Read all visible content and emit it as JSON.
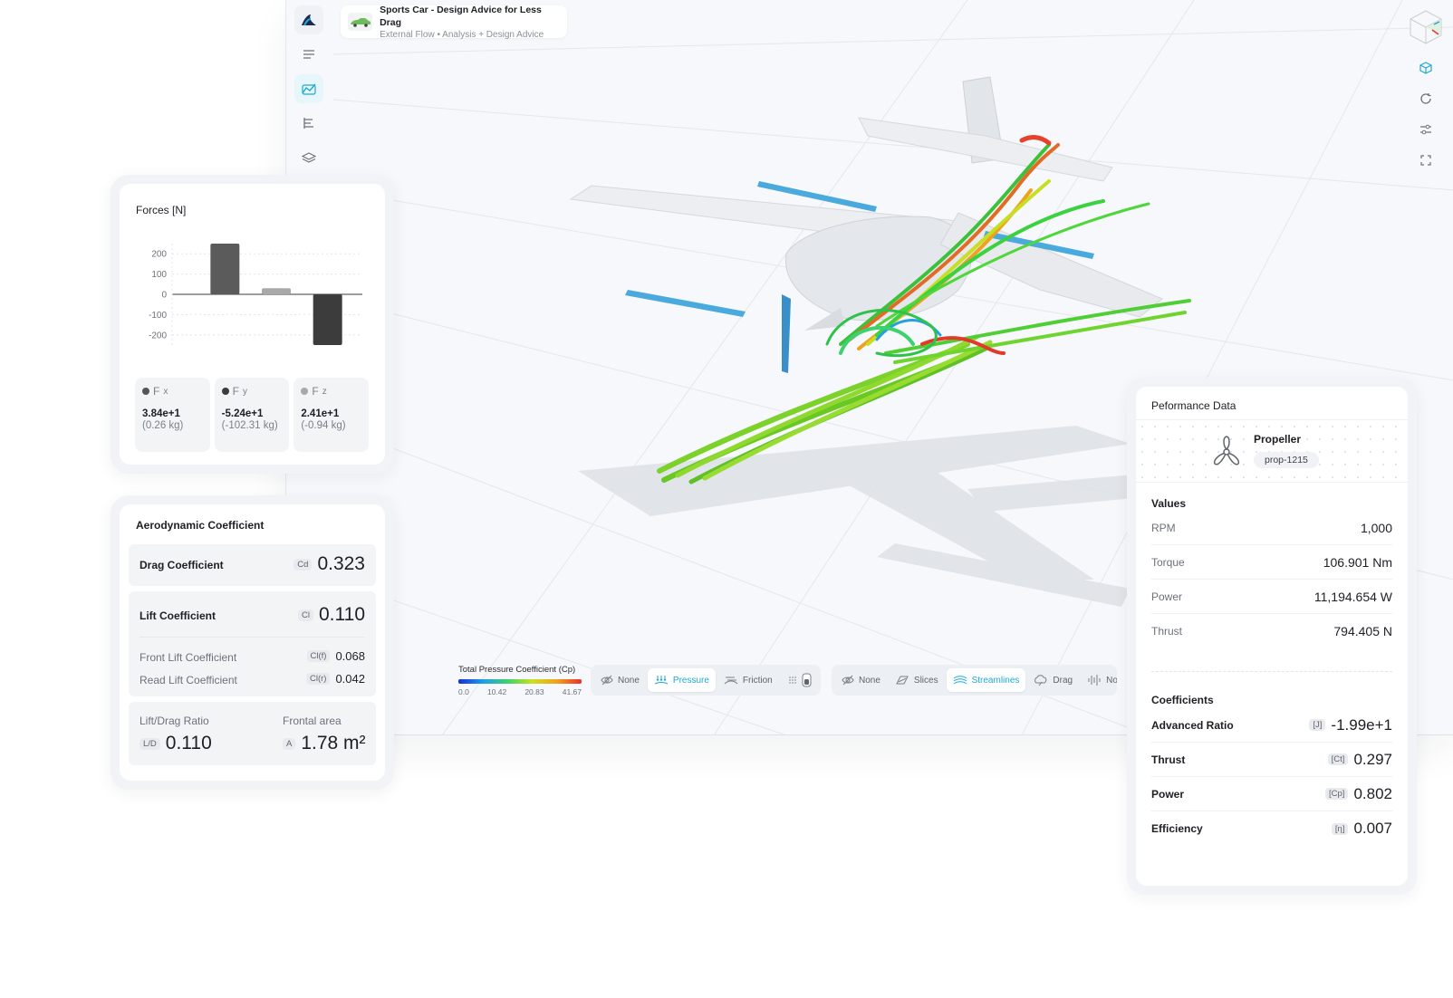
{
  "project": {
    "title": "Sports Car - Design Advice for Less Drag",
    "subtitle": "External Flow • Analysis + Design Advice"
  },
  "legend": {
    "title": "Total Pressure Coefficient (Cp)",
    "ticks": [
      "0.0",
      "10.42",
      "20.83",
      "41.67"
    ]
  },
  "surface_toggle": {
    "options": [
      {
        "label": "None",
        "icon": "eye-off-icon"
      },
      {
        "label": "Pressure",
        "icon": "pressure-icon",
        "active": true
      },
      {
        "label": "Friction",
        "icon": "friction-icon"
      }
    ]
  },
  "flow_toggle": {
    "options": [
      {
        "label": "None",
        "icon": "eye-off-icon"
      },
      {
        "label": "Slices",
        "icon": "slices-icon"
      },
      {
        "label": "Streamlines",
        "icon": "streamlines-icon",
        "active": true
      },
      {
        "label": "Drag",
        "icon": "drag-icon"
      },
      {
        "label": "No",
        "icon": "noise-icon"
      }
    ]
  },
  "forces": {
    "title": "Forces [N]",
    "cards": [
      {
        "axis": "F",
        "sub": "x",
        "value": "3.84e+1",
        "mass": "(0.26 kg)",
        "color": "#555555"
      },
      {
        "axis": "F",
        "sub": "y",
        "value": "-5.24e+1",
        "mass": "(-102.31 kg)",
        "color": "#3c3c3c"
      },
      {
        "axis": "F",
        "sub": "z",
        "value": "2.41e+1",
        "mass": "(-0.94 kg)",
        "color": "#a9a9a9"
      }
    ]
  },
  "chart_data": {
    "type": "bar",
    "title": "Forces [N]",
    "categories": [
      "Fx",
      "Fz",
      "Fy"
    ],
    "values": [
      250,
      30,
      -250
    ],
    "colors": [
      "#5b5b5b",
      "#a9a9a9",
      "#3c3c3c"
    ],
    "yticks": [
      "200",
      "100",
      "0",
      "-100",
      "-200"
    ],
    "ylim": [
      -250,
      250
    ],
    "grid": true
  },
  "aero": {
    "title": "Aerodynamic Coefficient",
    "drag": {
      "label": "Drag Coefficient",
      "symbol": "Cd",
      "value": "0.323"
    },
    "lift": {
      "label": "Lift Coefficient",
      "symbol": "Cl",
      "value": "0.110"
    },
    "front_lift": {
      "label": "Front Lift Coefficient",
      "symbol": "Cl(f)",
      "value": "0.068"
    },
    "read_lift": {
      "label": "Read Lift Coefficient",
      "symbol": "Cl(r)",
      "value": "0.042"
    },
    "ld": {
      "label": "Lift/Drag Ratio",
      "symbol": "L/D",
      "value": "0.110"
    },
    "area": {
      "label": "Frontal area",
      "symbol": "A",
      "value": "1.78 m²"
    }
  },
  "performance": {
    "title": "Peformance Data",
    "propeller": {
      "name": "Propeller",
      "id": "prop-1215"
    },
    "values_title": "Values",
    "values": [
      {
        "label": "RPM",
        "value": "1,000"
      },
      {
        "label": "Torque",
        "value": "106.901 Nm"
      },
      {
        "label": "Power",
        "value": "11,194.654 W"
      },
      {
        "label": "Thrust",
        "value": "794.405 N"
      }
    ],
    "coefficients_title": "Coefficients",
    "coefficients": [
      {
        "label": "Advanced Ratio",
        "symbol": "[J]",
        "value": "-1.99e+1"
      },
      {
        "label": "Thrust",
        "symbol": "[Ct]",
        "value": "0.297"
      },
      {
        "label": "Power",
        "symbol": "[Cp]",
        "value": "0.802"
      },
      {
        "label": "Efficiency",
        "symbol": "[η]",
        "value": "0.007"
      }
    ]
  },
  "colors": {
    "accent": "#1fa8d6",
    "bar_dark": "#3c3c3c",
    "bar_mid": "#5b5b5b",
    "bar_light": "#a9a9a9"
  }
}
